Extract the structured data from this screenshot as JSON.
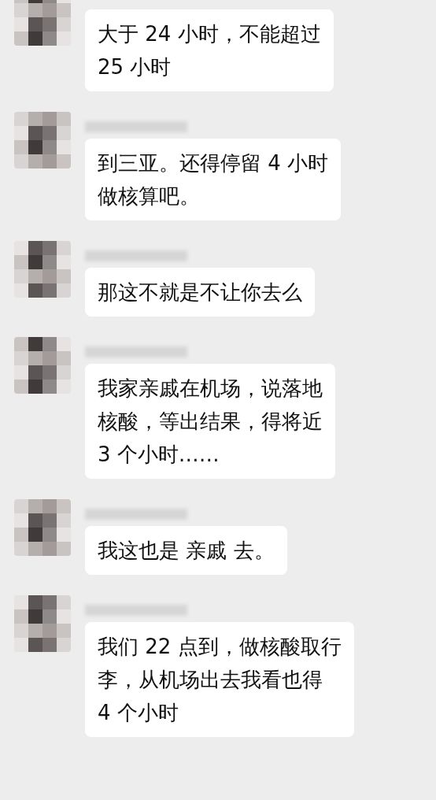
{
  "messages": [
    {
      "name_shown": false,
      "lines": [
        "大于 24 小时，不能超过",
        "25 小时"
      ]
    },
    {
      "name_shown": true,
      "lines": [
        "到三亚。还得停留 4 小时",
        "做核算吧。"
      ]
    },
    {
      "name_shown": true,
      "lines": [
        "那这不就是不让你去么"
      ]
    },
    {
      "name_shown": true,
      "lines": [
        "我家亲戚在机场，说落地",
        "核酸，等出结果，得将近",
        "3 个小时……"
      ]
    },
    {
      "name_shown": true,
      "lines": [
        "我这也是 亲戚 去。"
      ]
    },
    {
      "name_shown": true,
      "lines": [
        "我们 22 点到，做核酸取行",
        "李，从机场出去我看也得",
        "4 个小时"
      ]
    }
  ]
}
